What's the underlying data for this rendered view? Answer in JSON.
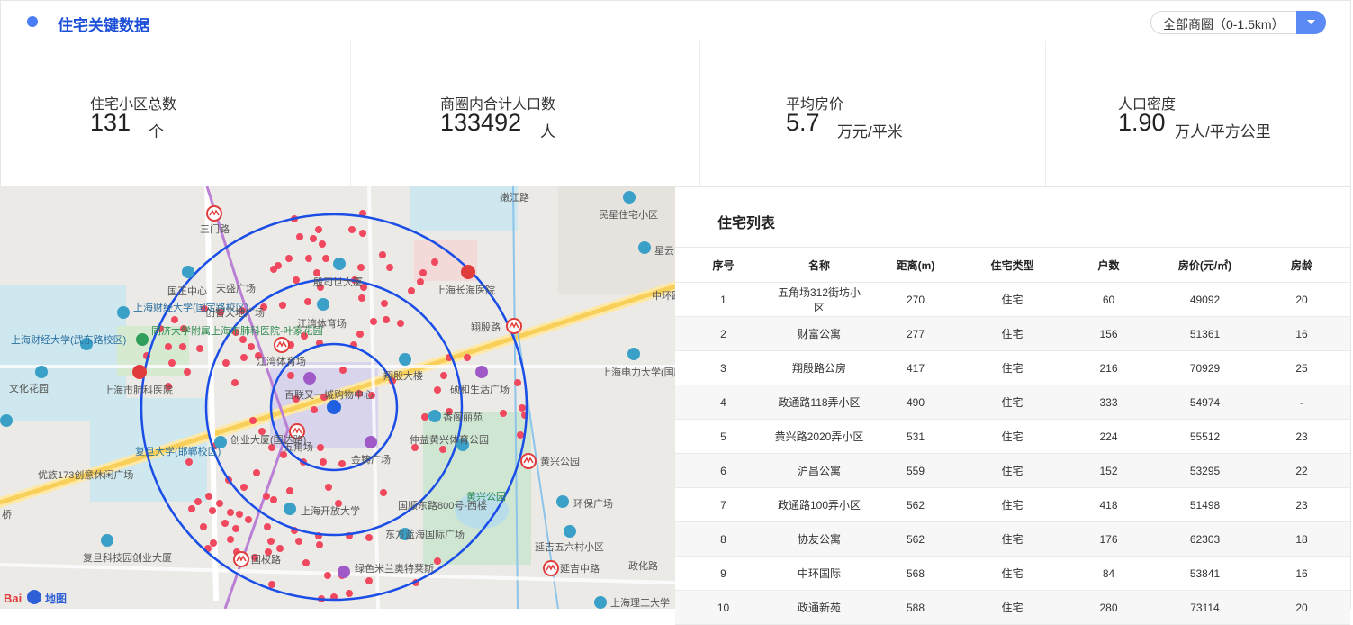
{
  "header": {
    "title": "住宅关键数据",
    "dropdown_value": "全部商圈（0-1.5km）"
  },
  "stats": [
    {
      "label": "住宅小区总数",
      "value": "131",
      "unit": "个"
    },
    {
      "label": "商圈内合计人口数",
      "value": "133492",
      "unit": "人"
    },
    {
      "label": "平均房价",
      "value": "5.7",
      "unit": "万元/平米"
    },
    {
      "label": "人口密度",
      "value": "1.90",
      "unit": "万人/平方公里"
    }
  ],
  "map": {
    "logo_text": "Bai",
    "logo_text2": "地图",
    "labels": {
      "l1": "三门路",
      "l2": "嫩江路",
      "l3": "民星住宅小区",
      "l4": "星云",
      "l5": "天盛广场",
      "l6": "国正中心",
      "l7": "上海财经大学(国定路校区)",
      "l8": "创智天地广场",
      "l9": "上海财经大学(武东路校区)",
      "l10": "同济大学附属上海市肺科医院-叶家花园",
      "l11": "文化花园",
      "l12": "上海市肺科医院",
      "l13": "江湾体育场",
      "l14": "江湾体育场",
      "l15": "殷司世大厦",
      "l16": "上海长海医院",
      "l17": "翔殷路",
      "l18": "中环路立",
      "l19": "上海电力大学(国顺东路校区)",
      "l20": "百联又一城购物中心",
      "l21": "翔殷大楼",
      "l22": "硕和生活广场",
      "l23": "香阁丽苑",
      "l24": "五角场",
      "l25": "仲益黄兴体育公园",
      "l26": "创业大厦(国达路)",
      "l27": "复旦大学(邯郸校区)",
      "l28": "金铸广场",
      "l29": "优族173创意休闲广场",
      "l30": "黄兴公园",
      "l31": "黄兴公园",
      "l32": "上海开放大学",
      "l33": "国顺东路800号-西楼",
      "l34": "东方蓝海国际广场",
      "l35": "环保广场",
      "l36": "复旦科技园创业大厦",
      "l37": "国权路",
      "l38": "绿色米兰奥特莱斯",
      "l39": "延吉五六村小区",
      "l40": "延吉中路",
      "l41": "上海理工大学",
      "l42": "政化路",
      "l43": "桥"
    }
  },
  "table": {
    "title": "住宅列表",
    "columns": [
      "序号",
      "名称",
      "距离(m)",
      "住宅类型",
      "户数",
      "房价(元/㎡)",
      "房龄"
    ],
    "rows": [
      [
        "1",
        "五角场312街坊小区",
        "270",
        "住宅",
        "60",
        "49092",
        "20"
      ],
      [
        "2",
        "财富公寓",
        "277",
        "住宅",
        "156",
        "51361",
        "16"
      ],
      [
        "3",
        "翔殷路公房",
        "417",
        "住宅",
        "216",
        "70929",
        "25"
      ],
      [
        "4",
        "政通路118弄小区",
        "490",
        "住宅",
        "333",
        "54974",
        "-"
      ],
      [
        "5",
        "黄兴路2020弄小区",
        "531",
        "住宅",
        "224",
        "55512",
        "23"
      ],
      [
        "6",
        "沪昌公寓",
        "559",
        "住宅",
        "152",
        "53295",
        "22"
      ],
      [
        "7",
        "政通路100弄小区",
        "562",
        "住宅",
        "418",
        "51498",
        "23"
      ],
      [
        "8",
        "协友公寓",
        "562",
        "住宅",
        "176",
        "62303",
        "18"
      ],
      [
        "9",
        "中环国际",
        "568",
        "住宅",
        "84",
        "53841",
        "16"
      ],
      [
        "10",
        "政通新苑",
        "588",
        "住宅",
        "280",
        "73114",
        "20"
      ]
    ]
  },
  "colors": {
    "accent": "#4a7cf5",
    "title_blue": "#1c4fd8",
    "ring_blue": "#1a4ee6",
    "poi_red": "#f0485e",
    "metro_red": "#e03c3c",
    "center_dot": "#1f5fe0"
  }
}
